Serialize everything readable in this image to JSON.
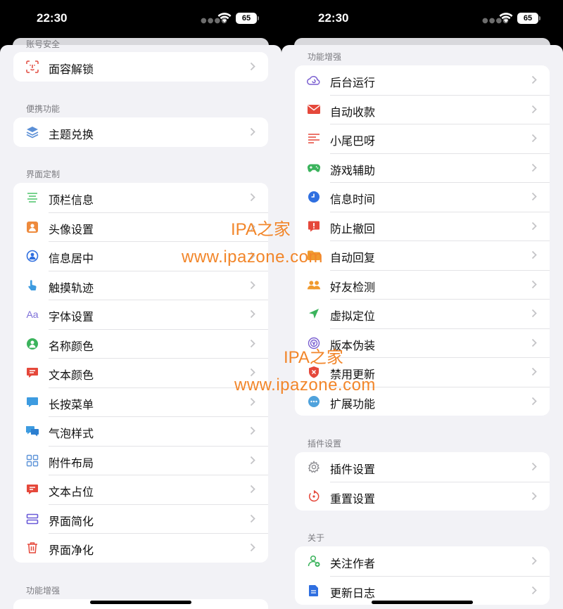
{
  "status_bar": {
    "time": "22:30",
    "battery": "65"
  },
  "left": {
    "partial_header": "账号安全",
    "groups": [
      {
        "title": "",
        "items": [
          {
            "label": "面容解锁",
            "icon": "faceid-icon"
          }
        ]
      },
      {
        "title": "便携功能",
        "items": [
          {
            "label": "主题兑换",
            "icon": "layers-icon"
          }
        ]
      },
      {
        "title": "界面定制",
        "items": [
          {
            "label": "顶栏信息",
            "icon": "topbar-lines-icon"
          },
          {
            "label": "头像设置",
            "icon": "avatar-frame-icon"
          },
          {
            "label": "信息居中",
            "icon": "person-circle-icon"
          },
          {
            "label": "触摸轨迹",
            "icon": "touch-hand-icon"
          },
          {
            "label": "字体设置",
            "icon": "font-aa-icon"
          },
          {
            "label": "名称颜色",
            "icon": "person-color-icon"
          },
          {
            "label": "文本颜色",
            "icon": "text-bubble-icon"
          },
          {
            "label": "长按菜单",
            "icon": "menu-bubble-icon"
          },
          {
            "label": "气泡样式",
            "icon": "chat-bubbles-icon"
          },
          {
            "label": "附件布局",
            "icon": "grid-layout-icon"
          },
          {
            "label": "文本占位",
            "icon": "text-placeholder-icon"
          },
          {
            "label": "界面简化",
            "icon": "simplify-icon"
          },
          {
            "label": "界面净化",
            "icon": "trash-icon"
          }
        ]
      },
      {
        "title": "功能增强",
        "items": []
      }
    ]
  },
  "right": {
    "groups": [
      {
        "title": "功能增强",
        "items": [
          {
            "label": "后台运行",
            "icon": "cloud-sync-icon"
          },
          {
            "label": "自动收款",
            "icon": "mail-icon"
          },
          {
            "label": "小尾巴呀",
            "icon": "text-lines-icon"
          },
          {
            "label": "游戏辅助",
            "icon": "gamepad-icon"
          },
          {
            "label": "信息时间",
            "icon": "clock-icon"
          },
          {
            "label": "防止撤回",
            "icon": "alert-bubble-icon"
          },
          {
            "label": "自动回复",
            "icon": "folder-icon"
          },
          {
            "label": "好友检测",
            "icon": "people-icon"
          },
          {
            "label": "虚拟定位",
            "icon": "location-arrow-icon"
          },
          {
            "label": "版本伪装",
            "icon": "version-badge-icon"
          },
          {
            "label": "禁用更新",
            "icon": "shield-block-icon"
          },
          {
            "label": "扩展功能",
            "icon": "more-dots-icon"
          }
        ]
      },
      {
        "title": "插件设置",
        "items": [
          {
            "label": "插件设置",
            "icon": "gear-icon"
          },
          {
            "label": "重置设置",
            "icon": "reset-icon"
          }
        ]
      },
      {
        "title": "关于",
        "items": [
          {
            "label": "关注作者",
            "icon": "person-add-icon"
          },
          {
            "label": "更新日志",
            "icon": "document-icon"
          }
        ]
      }
    ]
  },
  "watermarks": [
    {
      "title": "IPA之家",
      "url": "www.ipazone.com"
    },
    {
      "title": "IPA之家",
      "url": "www.ipazone.com"
    }
  ]
}
